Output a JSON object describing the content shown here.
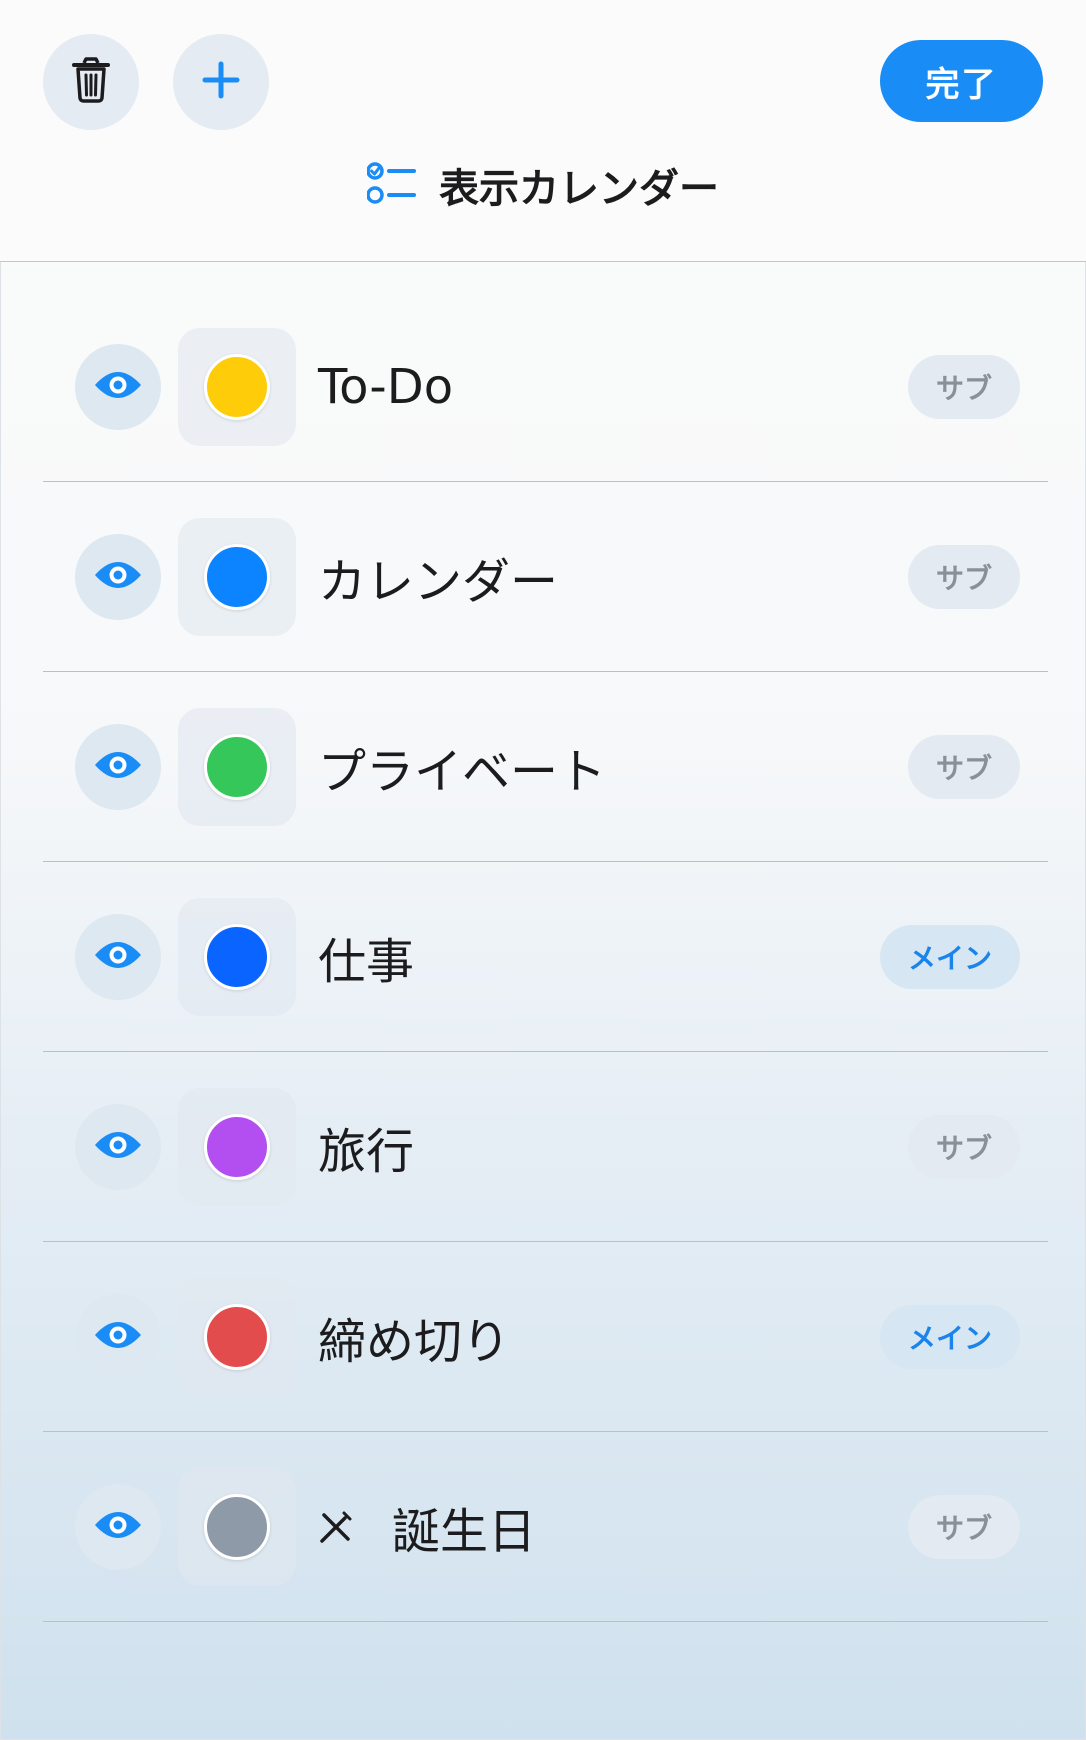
{
  "header": {
    "title": "表示カレンダー",
    "done_label": "完了",
    "trash_icon": "trash-icon",
    "add_icon": "plus-icon",
    "title_icon": "checklist-icon"
  },
  "colors": {
    "accent": "#1a8cf5",
    "badge_main_text": "#1a84ec",
    "badge_sub_text": "#8a9097"
  },
  "calendars": [
    {
      "name": "To-Do",
      "color": "#ffcc0a",
      "badge": "サブ",
      "badge_type": "sub",
      "visible": true
    },
    {
      "name": "カレンダー",
      "color": "#0d84ff",
      "badge": "サブ",
      "badge_type": "sub",
      "visible": true
    },
    {
      "name": "プライベート",
      "color": "#35c759",
      "badge": "サブ",
      "badge_type": "sub",
      "visible": true
    },
    {
      "name": "仕事",
      "color": "#0a64ff",
      "badge": "メイン",
      "badge_type": "main",
      "visible": true
    },
    {
      "name": "旅行",
      "color": "#b34ff0",
      "badge": "サブ",
      "badge_type": "sub",
      "visible": true
    },
    {
      "name": "締め切り",
      "color": "#e24c4c",
      "badge": "メイン",
      "badge_type": "main",
      "visible": true
    },
    {
      "name": "誕生日",
      "color": "#8e9aa8",
      "badge": "サブ",
      "badge_type": "sub",
      "visible": true,
      "icon": "party-popper-icon"
    }
  ]
}
